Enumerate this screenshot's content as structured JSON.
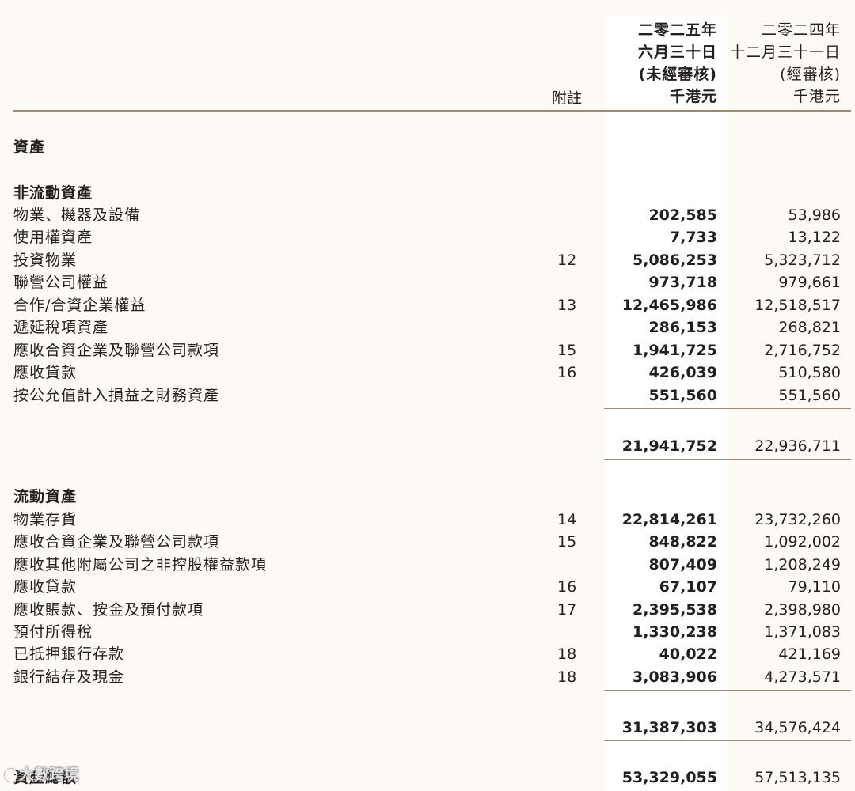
{
  "header": {
    "note_label": "附註",
    "current": {
      "line1": "二零二五年",
      "line2": "六月三十日",
      "line3": "(未經審核)",
      "unit": "千港元"
    },
    "previous": {
      "line1": "二零二四年",
      "line2": "十二月三十一日",
      "line3": "(經審核)",
      "unit": "千港元"
    }
  },
  "section_title": "資產",
  "non_current": {
    "heading": "非流動資產",
    "rows": [
      {
        "label": "物業、機器及設備",
        "note": "",
        "current": "202,585",
        "previous": "53,986"
      },
      {
        "label": "使用權資產",
        "note": "",
        "current": "7,733",
        "previous": "13,122"
      },
      {
        "label": "投資物業",
        "note": "12",
        "current": "5,086,253",
        "previous": "5,323,712"
      },
      {
        "label": "聯營公司權益",
        "note": "",
        "current": "973,718",
        "previous": "979,661"
      },
      {
        "label": "合作/合資企業權益",
        "note": "13",
        "current": "12,465,986",
        "previous": "12,518,517"
      },
      {
        "label": "遞延稅項資產",
        "note": "",
        "current": "286,153",
        "previous": "268,821"
      },
      {
        "label": "應收合資企業及聯營公司款項",
        "note": "15",
        "current": "1,941,725",
        "previous": "2,716,752"
      },
      {
        "label": "應收貸款",
        "note": "16",
        "current": "426,039",
        "previous": "510,580"
      },
      {
        "label": "按公允值計入損益之財務資產",
        "note": "",
        "current": "551,560",
        "previous": "551,560"
      }
    ],
    "subtotal": {
      "current": "21,941,752",
      "previous": "22,936,711"
    }
  },
  "current_assets": {
    "heading": "流動資產",
    "rows": [
      {
        "label": "物業存貨",
        "note": "14",
        "current": "22,814,261",
        "previous": "23,732,260"
      },
      {
        "label": "應收合資企業及聯營公司款項",
        "note": "15",
        "current": "848,822",
        "previous": "1,092,002"
      },
      {
        "label": "應收其他附屬公司之非控股權益款項",
        "note": "",
        "current": "807,409",
        "previous": "1,208,249"
      },
      {
        "label": "應收貸款",
        "note": "16",
        "current": "67,107",
        "previous": "79,110"
      },
      {
        "label": "應收賬款、按金及預付款項",
        "note": "17",
        "current": "2,395,538",
        "previous": "2,398,980"
      },
      {
        "label": "預付所得稅",
        "note": "",
        "current": "1,330,238",
        "previous": "1,371,083"
      },
      {
        "label": "已抵押銀行存款",
        "note": "18",
        "current": "40,022",
        "previous": "421,169"
      },
      {
        "label": "銀行結存及現金",
        "note": "18",
        "current": "3,083,906",
        "previous": "4,273,571"
      }
    ],
    "subtotal": {
      "current": "31,387,303",
      "previous": "34,576,424"
    }
  },
  "total": {
    "label": "資產總額",
    "current": "53,329,055",
    "previous": "57,513,135"
  },
  "watermark": {
    "text": "大數跨境"
  },
  "colors": {
    "rule": "#a08a6e",
    "page_bg": "#fdfaf5",
    "column_bg": "#ffffff"
  }
}
